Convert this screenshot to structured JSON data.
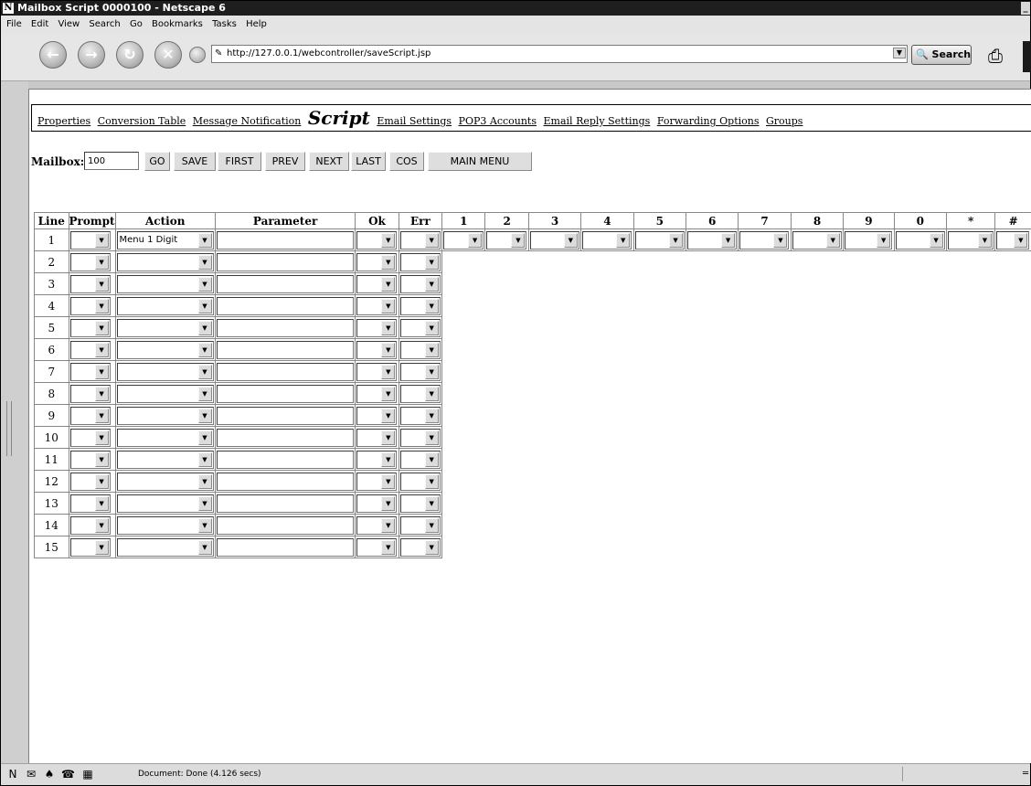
{
  "window": {
    "title": "Mailbox Script 0000100 - Netscape 6",
    "logo": "N"
  },
  "menubar": [
    "File",
    "Edit",
    "View",
    "Search",
    "Go",
    "Bookmarks",
    "Tasks",
    "Help"
  ],
  "toolbar": {
    "url": "http://127.0.0.1/webcontroller/saveScript.jsp",
    "search_label": "Search",
    "icons": [
      "back-icon",
      "forward-icon",
      "reload-icon",
      "stop-icon",
      "home-icon",
      "print-icon"
    ]
  },
  "nav": {
    "links": [
      "Properties",
      "Conversion Table",
      "Message Notification"
    ],
    "active": "Script",
    "links_after": [
      "Email Settings",
      "POP3 Accounts",
      "Email Reply Settings",
      "Forwarding Options",
      "Groups"
    ]
  },
  "mailbox": {
    "label": "Mailbox:",
    "value": "100",
    "buttons": [
      "GO",
      "SAVE",
      "FIRST",
      "PREV",
      "NEXT",
      "LAST",
      "COS",
      "MAIN MENU"
    ]
  },
  "table": {
    "headers": [
      "Line",
      "Prompt",
      "Action",
      "Parameter",
      "Ok",
      "Err",
      "1",
      "2",
      "3",
      "4",
      "5",
      "6",
      "7",
      "8",
      "9",
      "0",
      "*",
      "#"
    ],
    "rows": [
      {
        "line": "1",
        "prompt": "",
        "action": "Menu 1 Digit",
        "parameter": "",
        "ok": "",
        "err": ""
      },
      {
        "line": "2",
        "prompt": "",
        "action": "",
        "parameter": "",
        "ok": "",
        "err": ""
      },
      {
        "line": "3",
        "prompt": "",
        "action": "",
        "parameter": "",
        "ok": "",
        "err": ""
      },
      {
        "line": "4",
        "prompt": "",
        "action": "",
        "parameter": "",
        "ok": "",
        "err": ""
      },
      {
        "line": "5",
        "prompt": "",
        "action": "",
        "parameter": "",
        "ok": "",
        "err": ""
      },
      {
        "line": "6",
        "prompt": "",
        "action": "",
        "parameter": "",
        "ok": "",
        "err": ""
      },
      {
        "line": "7",
        "prompt": "",
        "action": "",
        "parameter": "",
        "ok": "",
        "err": ""
      },
      {
        "line": "8",
        "prompt": "",
        "action": "",
        "parameter": "",
        "ok": "",
        "err": ""
      },
      {
        "line": "9",
        "prompt": "",
        "action": "",
        "parameter": "",
        "ok": "",
        "err": ""
      },
      {
        "line": "10",
        "prompt": "",
        "action": "",
        "parameter": "",
        "ok": "",
        "err": ""
      },
      {
        "line": "11",
        "prompt": "",
        "action": "",
        "parameter": "",
        "ok": "",
        "err": ""
      },
      {
        "line": "12",
        "prompt": "",
        "action": "",
        "parameter": "",
        "ok": "",
        "err": ""
      },
      {
        "line": "13",
        "prompt": "",
        "action": "",
        "parameter": "",
        "ok": "",
        "err": ""
      },
      {
        "line": "14",
        "prompt": "",
        "action": "",
        "parameter": "",
        "ok": "",
        "err": ""
      },
      {
        "line": "15",
        "prompt": "",
        "action": "",
        "parameter": "",
        "ok": "",
        "err": ""
      }
    ]
  },
  "status": {
    "text": "Document: Done (4.126 secs)"
  }
}
